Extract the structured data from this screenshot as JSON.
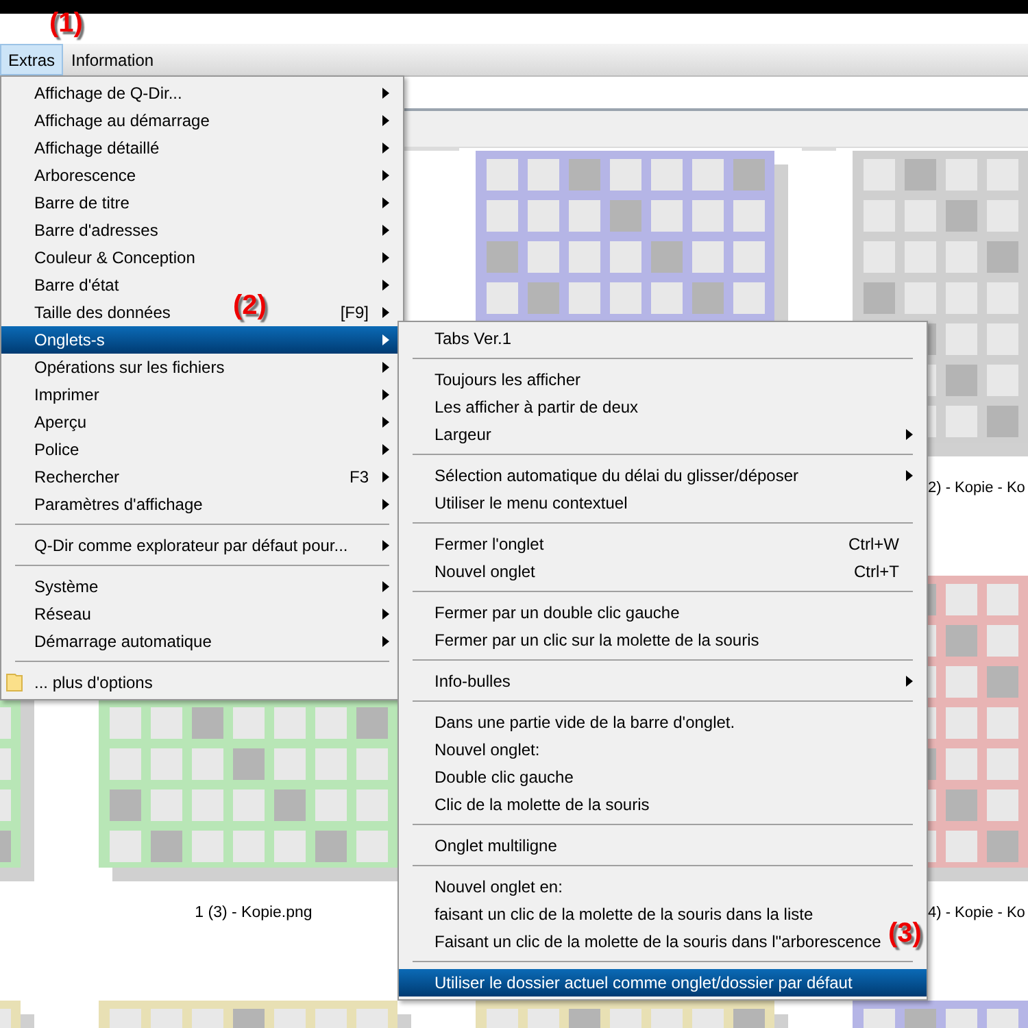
{
  "menubar": [
    {
      "label": "Extras",
      "selected": true
    },
    {
      "label": "Information",
      "selected": false
    }
  ],
  "thumbnails": [
    [
      {
        "kind": "covered"
      },
      {
        "kind": "covered"
      },
      {
        "kind": "image",
        "color": "#b5b5e6"
      },
      {
        "kind": "image",
        "color": "#cfcfcf",
        "label": "2) - Kopie - Ko"
      }
    ],
    [
      {
        "kind": "image",
        "color": "#b8e6b6"
      },
      {
        "kind": "image",
        "color": "#b8e6b6",
        "label": "1 (3) - Kopie.png"
      },
      {
        "kind": "covered"
      },
      {
        "kind": "image",
        "color": "#e8b4b4",
        "label": "4) - Kopie - Ko"
      }
    ],
    [
      {
        "kind": "image",
        "color": "#e8e0b4"
      },
      {
        "kind": "image",
        "color": "#e8e0b4"
      },
      {
        "kind": "image",
        "color": "#e8e0b4"
      },
      {
        "kind": "image",
        "color": "#b5b5e6"
      }
    ]
  ],
  "main_menu": [
    {
      "kind": "item",
      "label": "Affichage de Q-Dir...",
      "has_submenu": true,
      "selected": false
    },
    {
      "kind": "item",
      "label": "Affichage au démarrage",
      "has_submenu": true,
      "selected": false
    },
    {
      "kind": "item",
      "label": "Affichage détaillé",
      "has_submenu": true,
      "selected": false
    },
    {
      "kind": "item",
      "label": "Arborescence",
      "has_submenu": true,
      "selected": false
    },
    {
      "kind": "item",
      "label": "Barre de titre",
      "has_submenu": true,
      "selected": false
    },
    {
      "kind": "item",
      "label": "Barre d'adresses",
      "has_submenu": true,
      "selected": false
    },
    {
      "kind": "item",
      "label": "Couleur & Conception",
      "has_submenu": true,
      "selected": false
    },
    {
      "kind": "item",
      "label": "Barre d'état",
      "has_submenu": true,
      "selected": false
    },
    {
      "kind": "item",
      "label": "Taille des données",
      "shortcut": "[F9]",
      "has_submenu": true,
      "selected": false
    },
    {
      "kind": "item",
      "label": "Onglets-s",
      "has_submenu": true,
      "selected": true
    },
    {
      "kind": "item",
      "label": "Opérations sur les fichiers",
      "has_submenu": true,
      "selected": false
    },
    {
      "kind": "item",
      "label": "Imprimer",
      "has_submenu": true,
      "selected": false
    },
    {
      "kind": "item",
      "label": "Aperçu",
      "has_submenu": true,
      "selected": false
    },
    {
      "kind": "item",
      "label": "Police",
      "has_submenu": true,
      "selected": false
    },
    {
      "kind": "item",
      "label": "Rechercher",
      "shortcut": "F3",
      "has_submenu": true,
      "selected": false
    },
    {
      "kind": "item",
      "label": "Paramètres d'affichage",
      "has_submenu": true,
      "selected": false
    },
    {
      "kind": "separator"
    },
    {
      "kind": "item",
      "label": "Q-Dir comme explorateur par défaut pour...",
      "has_submenu": true,
      "selected": false
    },
    {
      "kind": "separator"
    },
    {
      "kind": "item",
      "label": "Système",
      "has_submenu": true,
      "selected": false
    },
    {
      "kind": "item",
      "label": "Réseau",
      "has_submenu": true,
      "selected": false
    },
    {
      "kind": "item",
      "label": "Démarrage automatique",
      "has_submenu": true,
      "selected": false
    },
    {
      "kind": "separator"
    },
    {
      "kind": "folder_item",
      "label": "... plus d'options",
      "has_submenu": false,
      "selected": false
    }
  ],
  "submenu": [
    {
      "kind": "item",
      "label": "Tabs Ver.1",
      "has_submenu": false,
      "selected": false
    },
    {
      "kind": "separator"
    },
    {
      "kind": "item",
      "label": "Toujours les afficher",
      "has_submenu": false,
      "selected": false
    },
    {
      "kind": "item",
      "label": "Les afficher à partir de deux",
      "has_submenu": false,
      "selected": false
    },
    {
      "kind": "item",
      "label": "Largeur",
      "has_submenu": true,
      "selected": false
    },
    {
      "kind": "separator"
    },
    {
      "kind": "item",
      "label": "Sélection automatique du délai du glisser/déposer",
      "has_submenu": true,
      "selected": false
    },
    {
      "kind": "item",
      "label": "Utiliser le menu contextuel",
      "has_submenu": false,
      "selected": false
    },
    {
      "kind": "separator"
    },
    {
      "kind": "item",
      "label": "Fermer l'onglet",
      "shortcut": "Ctrl+W",
      "has_submenu": false,
      "selected": false
    },
    {
      "kind": "item",
      "label": "Nouvel onglet",
      "shortcut": "Ctrl+T",
      "has_submenu": false,
      "selected": false
    },
    {
      "kind": "separator"
    },
    {
      "kind": "item",
      "label": "Fermer par un double clic gauche",
      "has_submenu": false,
      "selected": false
    },
    {
      "kind": "item",
      "label": "Fermer par un clic sur la molette de la souris",
      "has_submenu": false,
      "selected": false
    },
    {
      "kind": "separator"
    },
    {
      "kind": "item",
      "label": "Info-bulles",
      "has_submenu": true,
      "selected": false
    },
    {
      "kind": "separator"
    },
    {
      "kind": "item",
      "label": "Dans une partie vide de la barre d'onglet.",
      "has_submenu": false,
      "selected": false
    },
    {
      "kind": "item",
      "label": "Nouvel onglet:",
      "has_submenu": false,
      "selected": false
    },
    {
      "kind": "item",
      "label": "Double clic gauche",
      "has_submenu": false,
      "selected": false
    },
    {
      "kind": "item",
      "label": "Clic de la molette de la souris",
      "has_submenu": false,
      "selected": false
    },
    {
      "kind": "separator"
    },
    {
      "kind": "item",
      "label": "Onglet multiligne",
      "has_submenu": false,
      "selected": false
    },
    {
      "kind": "separator"
    },
    {
      "kind": "item",
      "label": "Nouvel onglet en:",
      "has_submenu": false,
      "selected": false
    },
    {
      "kind": "item",
      "label": "faisant un clic de la molette de la souris dans la liste",
      "has_submenu": false,
      "selected": false
    },
    {
      "kind": "item",
      "label": "Faisant un clic de la molette de la souris dans l\"arborescence",
      "has_submenu": false,
      "selected": false
    },
    {
      "kind": "separator"
    },
    {
      "kind": "item",
      "label": "Utiliser le dossier actuel comme onglet/dossier par défaut",
      "has_submenu": false,
      "selected": true
    }
  ],
  "annotations": [
    "(1)",
    "(2)",
    "(3)"
  ]
}
